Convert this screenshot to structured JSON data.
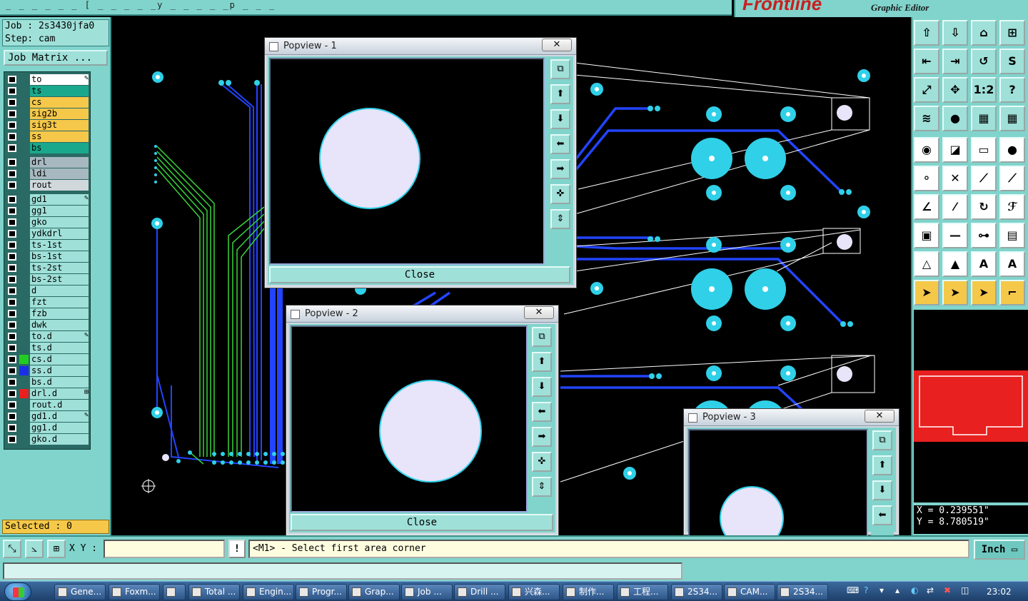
{
  "app": {
    "title_dashes": "_  _  _  _  _  _ [  _  _  _  _  _y  _  _  _  _ _p  _  _  _",
    "brand": "Frontline",
    "subtitle": "Graphic Editor"
  },
  "job": {
    "job_line": "Job : 2s3430jfa0",
    "step_line": "Step: cam",
    "matrix_button": "Job Matrix ..."
  },
  "layers": [
    {
      "name": "to",
      "color": "#ffffff",
      "mark": "✎"
    },
    {
      "name": "ts",
      "color": "#1aa88c",
      "mark": ""
    },
    {
      "name": "cs",
      "color": "#f5c84a",
      "mark": ""
    },
    {
      "name": "sig2b",
      "color": "#f5c84a",
      "mark": ""
    },
    {
      "name": "sig3t",
      "color": "#f5c84a",
      "mark": ""
    },
    {
      "name": "ss",
      "color": "#f5c84a",
      "mark": ""
    },
    {
      "name": "bs",
      "color": "#1aa88c",
      "mark": ""
    },
    {
      "name": "drl",
      "color": "#a8b8c0",
      "mark": ""
    },
    {
      "name": "ldi",
      "color": "#a8b8c0",
      "mark": ""
    },
    {
      "name": "rout",
      "color": "#d0d8dc",
      "mark": ""
    },
    {
      "name": "gd1",
      "color": "#9fe0d8",
      "mark": "✎"
    },
    {
      "name": "gg1",
      "color": "#9fe0d8",
      "mark": ""
    },
    {
      "name": "gko",
      "color": "#9fe0d8",
      "mark": ""
    },
    {
      "name": "ydkdrl",
      "color": "#9fe0d8",
      "mark": ""
    },
    {
      "name": "ts-1st",
      "color": "#9fe0d8",
      "mark": ""
    },
    {
      "name": "bs-1st",
      "color": "#9fe0d8",
      "mark": ""
    },
    {
      "name": "ts-2st",
      "color": "#9fe0d8",
      "mark": ""
    },
    {
      "name": "bs-2st",
      "color": "#9fe0d8",
      "mark": ""
    },
    {
      "name": "d",
      "color": "#9fe0d8",
      "mark": ""
    },
    {
      "name": "fzt",
      "color": "#9fe0d8",
      "mark": ""
    },
    {
      "name": "fzb",
      "color": "#9fe0d8",
      "mark": ""
    },
    {
      "name": "dwk",
      "color": "#9fe0d8",
      "mark": ""
    },
    {
      "name": "to.d",
      "color": "#9fe0d8",
      "mark": "✎"
    },
    {
      "name": "ts.d",
      "color": "#9fe0d8",
      "mark": ""
    },
    {
      "name": "cs.d",
      "color": "#9fe0d8",
      "mark": "",
      "swatch": "#22cc22"
    },
    {
      "name": "ss.d",
      "color": "#9fe0d8",
      "mark": "",
      "swatch": "#1a2ee8"
    },
    {
      "name": "bs.d",
      "color": "#9fe0d8",
      "mark": ""
    },
    {
      "name": "drl.d",
      "color": "#9fe0d8",
      "mark": "⊞",
      "swatch": "#e82020"
    },
    {
      "name": "rout.d",
      "color": "#9fe0d8",
      "mark": ""
    },
    {
      "name": "gd1.d",
      "color": "#9fe0d8",
      "mark": "✎"
    },
    {
      "name": "gg1.d",
      "color": "#9fe0d8",
      "mark": ""
    },
    {
      "name": "gko.d",
      "color": "#9fe0d8",
      "mark": ""
    }
  ],
  "selected_label": "Selected : 0",
  "command": {
    "xy_label": "X Y :",
    "xy_value": "",
    "excl": "!",
    "prompt": "<M1> - Select first area corner",
    "units": "Inch"
  },
  "coords": {
    "x": "X = 0.239551\"",
    "y": "Y = 8.780519\""
  },
  "popviews": [
    {
      "title": "Popview - 1",
      "close": "Close",
      "x_btn": "✕"
    },
    {
      "title": "Popview - 2",
      "close": "Close",
      "x_btn": "✕"
    },
    {
      "title": "Popview - 3",
      "x_btn": "✕"
    }
  ],
  "toolbar_icons": [
    "layer-up-icon",
    "layer-down-icon",
    "home-icon",
    "split-view-icon",
    "move-left-icon",
    "move-right-icon",
    "mirror-icon",
    "s-curve-icon",
    "fit-icon",
    "center-icon",
    "scale-1-2-icon",
    "help-icon",
    "filter-icon",
    "probe-icon",
    "graph-icon",
    "graph-alt-icon",
    "select-pad-icon",
    "diagonal-icon",
    "ruler-icon",
    "dot-icon",
    "connect-icon",
    "cross-icon",
    "line-node-icon",
    "line-node-alt-icon",
    "angle-icon",
    "slash-icon",
    "arc-icon",
    "ff-icon",
    "square-node-icon",
    "dash-icon",
    "dimension-icon",
    "shapes-icon",
    "triangle-icon",
    "triangle-up-icon",
    "triangle-red-icon",
    "triangle-blue-icon",
    "cursor-icon",
    "cursor-box-icon",
    "cursor-circle-icon",
    "step-icon"
  ],
  "toolbar_glyphs": [
    "⇧",
    "⇩",
    "⌂",
    "⊞",
    "⇤",
    "⇥",
    "↺",
    "S",
    "⤢",
    "✥",
    "1:2",
    "?",
    "≋",
    "●",
    "▦",
    "▦",
    "◉",
    "◪",
    "▭",
    "●",
    "⚬",
    "✕",
    "⟋",
    "⟋",
    "∠",
    "⁄",
    "↻",
    "ℱ",
    "▣",
    "—",
    "⊶",
    "▤",
    "△",
    "▲",
    "A",
    "A",
    "➤",
    "➤",
    "➤",
    "⌐"
  ],
  "taskbar": [
    {
      "label": "Gene..."
    },
    {
      "label": "Foxm..."
    },
    {
      "label": ""
    },
    {
      "label": "Total ..."
    },
    {
      "label": "Engin..."
    },
    {
      "label": "Progr..."
    },
    {
      "label": "Grap..."
    },
    {
      "label": "Job ..."
    },
    {
      "label": "Drill ..."
    },
    {
      "label": "兴森..."
    },
    {
      "label": "制作..."
    },
    {
      "label": "工程..."
    },
    {
      "label": "2S34..."
    },
    {
      "label": "CAM..."
    },
    {
      "label": "2S34..."
    }
  ],
  "clock": "23:02"
}
